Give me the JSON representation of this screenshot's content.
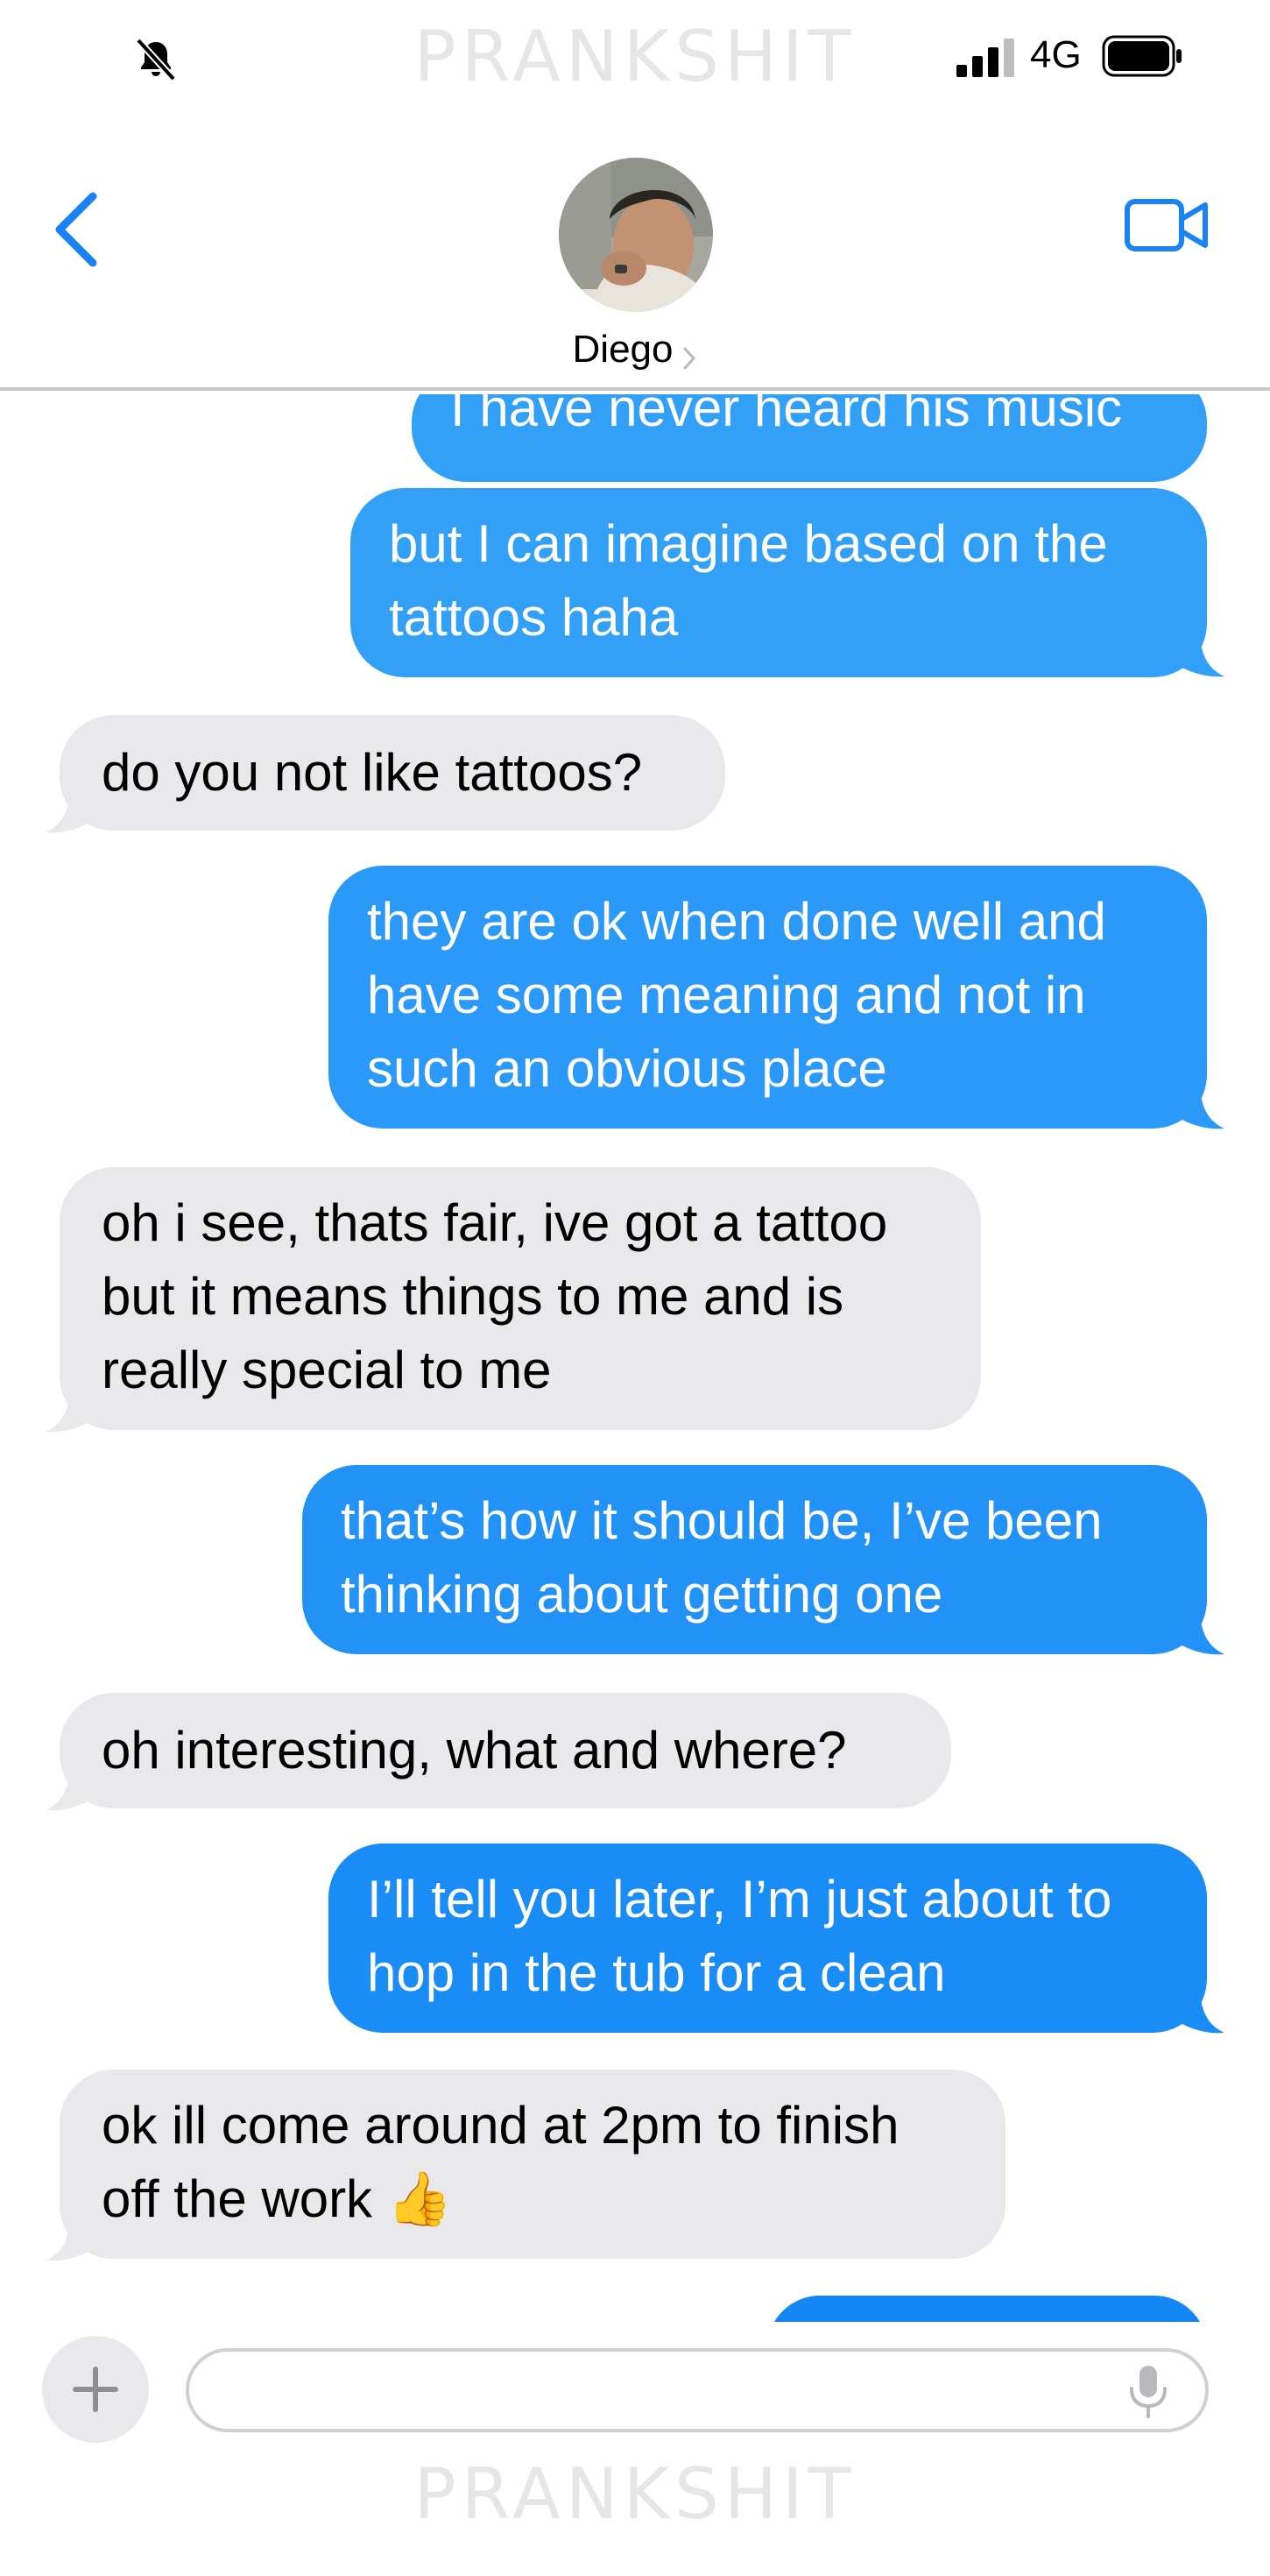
{
  "status_bar": {
    "network": "4G",
    "watermark": "PRANKSHIT",
    "icons": [
      "bell-slash-icon",
      "cellular-signal-icon",
      "battery-icon"
    ]
  },
  "header": {
    "contact_name": "Diego",
    "icons": [
      "chevron-left-icon",
      "chevron-right-icon",
      "video-camera-icon"
    ],
    "accent_color": "#1a82f5"
  },
  "messages": [
    {
      "direction": "sent",
      "lines": [
        "I have never heard his music"
      ]
    },
    {
      "direction": "sent",
      "lines": [
        "but I can imagine based on the",
        "tattoos haha"
      ]
    },
    {
      "direction": "received",
      "lines": [
        "do you not like tattoos?"
      ]
    },
    {
      "direction": "sent",
      "lines": [
        "they are ok when done well and",
        "have some meaning and not in",
        "such an obvious place"
      ]
    },
    {
      "direction": "received",
      "lines": [
        "oh i see, thats fair, ive got a tattoo",
        "but it means things to me and is",
        "really special to me"
      ]
    },
    {
      "direction": "sent",
      "lines": [
        "that’s how it should be, I’ve been",
        "thinking about getting one"
      ]
    },
    {
      "direction": "received",
      "lines": [
        "oh interesting, what and where?"
      ]
    },
    {
      "direction": "sent",
      "lines": [
        "I’ll tell you later, I’m just about to",
        "hop in the tub for a clean"
      ]
    },
    {
      "direction": "received",
      "lines": [
        "ok ill come around at 2pm to finish",
        "off the work 👍"
      ]
    },
    {
      "direction": "sent",
      "lines": []
    }
  ],
  "colors": {
    "sent_bubble": "#1a8cf5",
    "received_bubble": "#e9e9eb",
    "watermark": "#e6e6e6"
  },
  "input_bar": {
    "placeholder": "",
    "icons": [
      "plus-icon",
      "microphone-icon"
    ]
  },
  "footer": {
    "watermark": "PRANKSHIT"
  }
}
